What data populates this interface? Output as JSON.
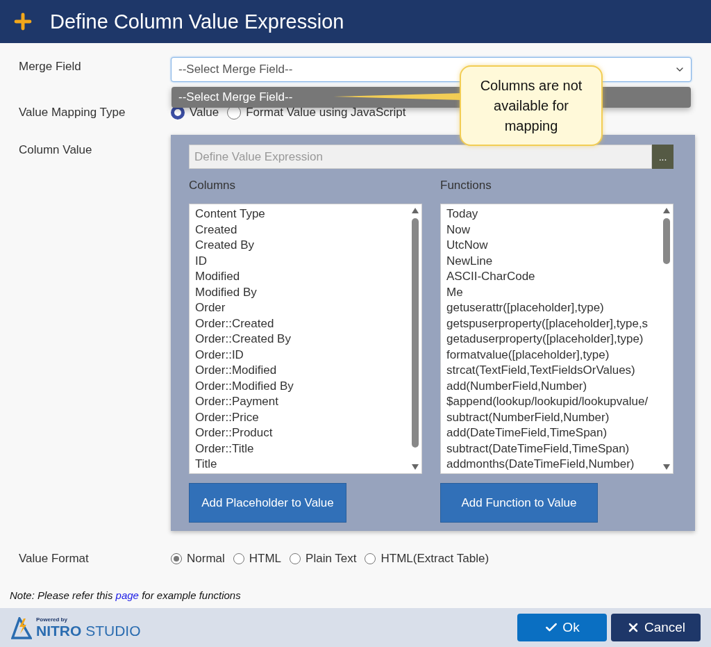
{
  "header": {
    "title": "Define Column Value Expression"
  },
  "merge_field": {
    "label": "Merge Field",
    "value": "--Select Merge Field--",
    "expanded": true,
    "options": [
      {
        "label": "--Select Merge Field--",
        "selected": true
      }
    ]
  },
  "callout": {
    "text": "Columns are not available for mapping"
  },
  "value_mapping_type": {
    "label": "Value Mapping Type",
    "options": [
      {
        "label": "Value",
        "selected": true
      },
      {
        "label": "Format Value using JavaScript",
        "selected": false
      }
    ]
  },
  "column_value": {
    "label": "Column Value",
    "expression": {
      "placeholder": "Define Value Expression",
      "button": "..."
    },
    "columns": {
      "title": "Columns",
      "items": [
        "Content Type",
        "Created",
        "Created By",
        "ID",
        "Modified",
        "Modified By",
        "Order",
        "Order::Created",
        "Order::Created By",
        "Order::ID",
        "Order::Modified",
        "Order::Modified By",
        "Order::Payment",
        "Order::Price",
        "Order::Product",
        "Order::Title",
        "Title"
      ],
      "button": "Add Placeholder to Value"
    },
    "functions": {
      "title": "Functions",
      "items": [
        "Today",
        "Now",
        "UtcNow",
        "NewLine",
        "ASCII-CharCode",
        "Me",
        "getuserattr([placeholder],type)",
        "getspuserproperty([placeholder],type,s",
        "getaduserproperty([placeholder],type)",
        "formatvalue([placeholder],type)",
        "strcat(TextField,TextFieldsOrValues)",
        "add(NumberField,Number)",
        "$append(lookup/lookupid/lookupvalue/",
        "subtract(NumberField,Number)",
        "add(DateTimeField,TimeSpan)",
        "subtract(DateTimeField,TimeSpan)",
        "addmonths(DateTimeField,Number)"
      ],
      "button": "Add Function to Value"
    }
  },
  "value_format": {
    "label": "Value Format",
    "options": [
      {
        "label": "Normal",
        "selected": true
      },
      {
        "label": "HTML",
        "selected": false
      },
      {
        "label": "Plain Text",
        "selected": false
      },
      {
        "label": "HTML(Extract Table)",
        "selected": false
      }
    ]
  },
  "note": {
    "before": "Note: Please refer this",
    "link": "page",
    "after": "for example functions"
  },
  "footer": {
    "logo_small": "Powered by",
    "logo_bold": "NITRO",
    "logo_light": "STUDIO",
    "ok": "Ok",
    "cancel": "Cancel"
  }
}
